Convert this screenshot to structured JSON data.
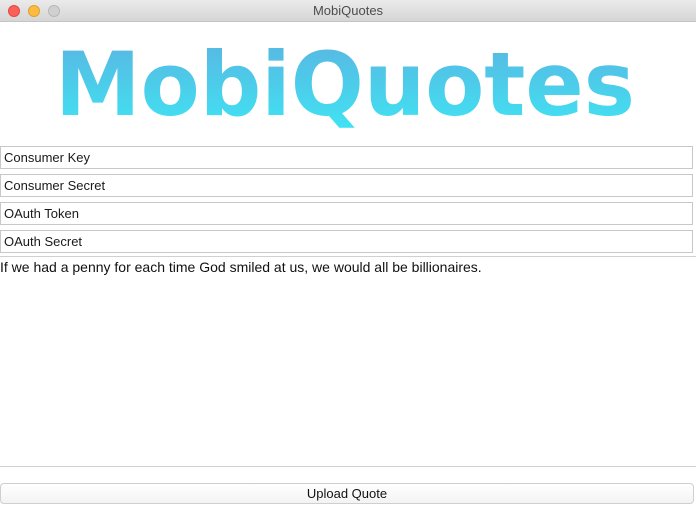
{
  "window": {
    "title": "MobiQuotes"
  },
  "logo": {
    "text": "MobiQuotes",
    "gradient_top": "#5bb3e0",
    "gradient_bottom": "#3ee6f4"
  },
  "fields": {
    "consumer_key": {
      "placeholder": "Consumer Key",
      "value": ""
    },
    "consumer_secret": {
      "placeholder": "Consumer Secret",
      "value": ""
    },
    "oauth_token": {
      "placeholder": "OAuth Token",
      "value": ""
    },
    "oauth_secret": {
      "placeholder": "OAuth Secret",
      "value": ""
    }
  },
  "quote": {
    "text": "If we had a penny for each time God smiled at us, we would all be billionaires."
  },
  "actions": {
    "upload_label": "Upload Quote"
  }
}
